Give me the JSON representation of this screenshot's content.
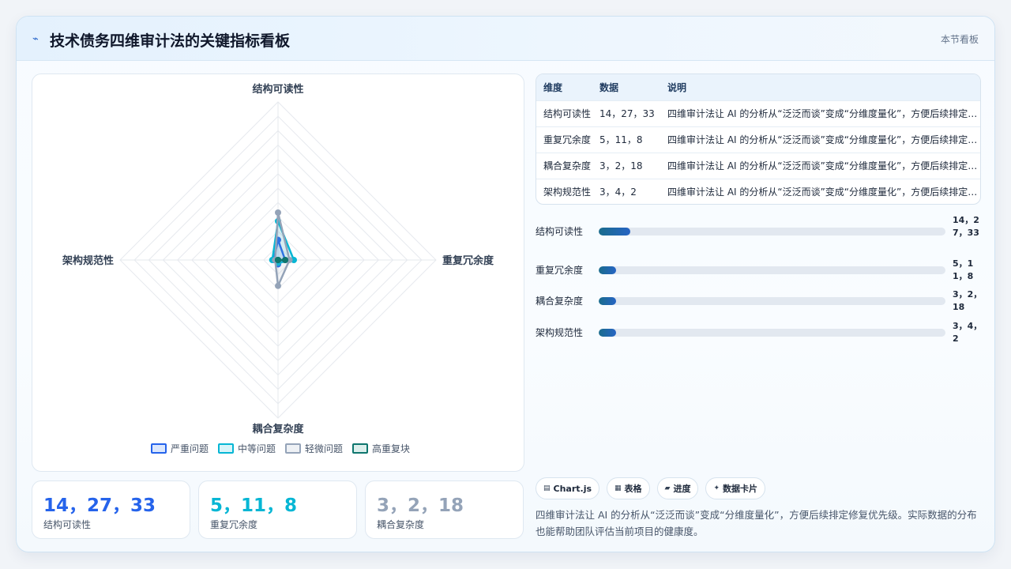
{
  "header": {
    "title_icon": "lightning-icon",
    "title": "技术债务四维审计法的关键指标看板",
    "meta": "本节看板"
  },
  "chart_data": {
    "type": "radar",
    "axes": [
      "结构可读性",
      "重复冗余度",
      "耦合复杂度",
      "架构规范性"
    ],
    "series": [
      {
        "name": "严重问题",
        "color": "#2563eb",
        "values": [
          14,
          5,
          3,
          3
        ]
      },
      {
        "name": "中等问题",
        "color": "#06b6d4",
        "values": [
          27,
          11,
          2,
          4
        ]
      },
      {
        "name": "轻微问题",
        "color": "#94a3b8",
        "values": [
          33,
          8,
          18,
          2
        ]
      },
      {
        "name": "高重复块",
        "color": "#0f766e",
        "values": [
          0,
          5,
          0,
          0
        ]
      }
    ],
    "rmax": 110,
    "grid_levels": 11,
    "grid": true,
    "legend_position": "bottom"
  },
  "stats": [
    {
      "value": "14，27，33",
      "label": "结构可读性",
      "color": "#2563eb"
    },
    {
      "value": "5，11，8",
      "label": "重复冗余度",
      "color": "#06b6d4"
    },
    {
      "value": "3，2，18",
      "label": "耦合复杂度",
      "color": "#94a3b8"
    }
  ],
  "table": {
    "headers": [
      "维度",
      "数据",
      "说明"
    ],
    "rows": [
      [
        "结构可读性",
        "14，27，33",
        "四维审计法让 AI 的分析从“泛泛而谈”变成“分维度量化”，方便后续排定修复优先级。"
      ],
      [
        "重复冗余度",
        "5，11，8",
        "四维审计法让 AI 的分析从“泛泛而谈”变成“分维度量化”，方便后续排定修复优先级。"
      ],
      [
        "耦合复杂度",
        "3，2，18",
        "四维审计法让 AI 的分析从“泛泛而谈”变成“分维度量化”，方便后续排定修复优先级。"
      ],
      [
        "架构规范性",
        "3，4，2",
        "四维审计法让 AI 的分析从“泛泛而谈”变成“分维度量化”，方便后续排定修复优先级。"
      ]
    ]
  },
  "progress": [
    {
      "label": "结构可读性",
      "value": "14，27，33",
      "fraction": 0.09
    },
    {
      "label": "重复冗余度",
      "value": "5，11，8",
      "fraction": 0.05
    },
    {
      "label": "耦合复杂度",
      "value": "3，2，18",
      "fraction": 0.05
    },
    {
      "label": "架构规范性",
      "value": "3，4，2",
      "fraction": 0.05
    }
  ],
  "tags": [
    {
      "icon": "chart-icon",
      "label": "Chart.js"
    },
    {
      "icon": "table-icon",
      "label": "表格"
    },
    {
      "icon": "progress-icon",
      "label": "进度"
    },
    {
      "icon": "card-icon",
      "label": "数据卡片"
    }
  ],
  "description": "四维审计法让 AI 的分析从“泛泛而谈”变成“分维度量化”，方便后续排定修复优先级。实际数据的分布也能帮助团队评估当前项目的健康度。"
}
